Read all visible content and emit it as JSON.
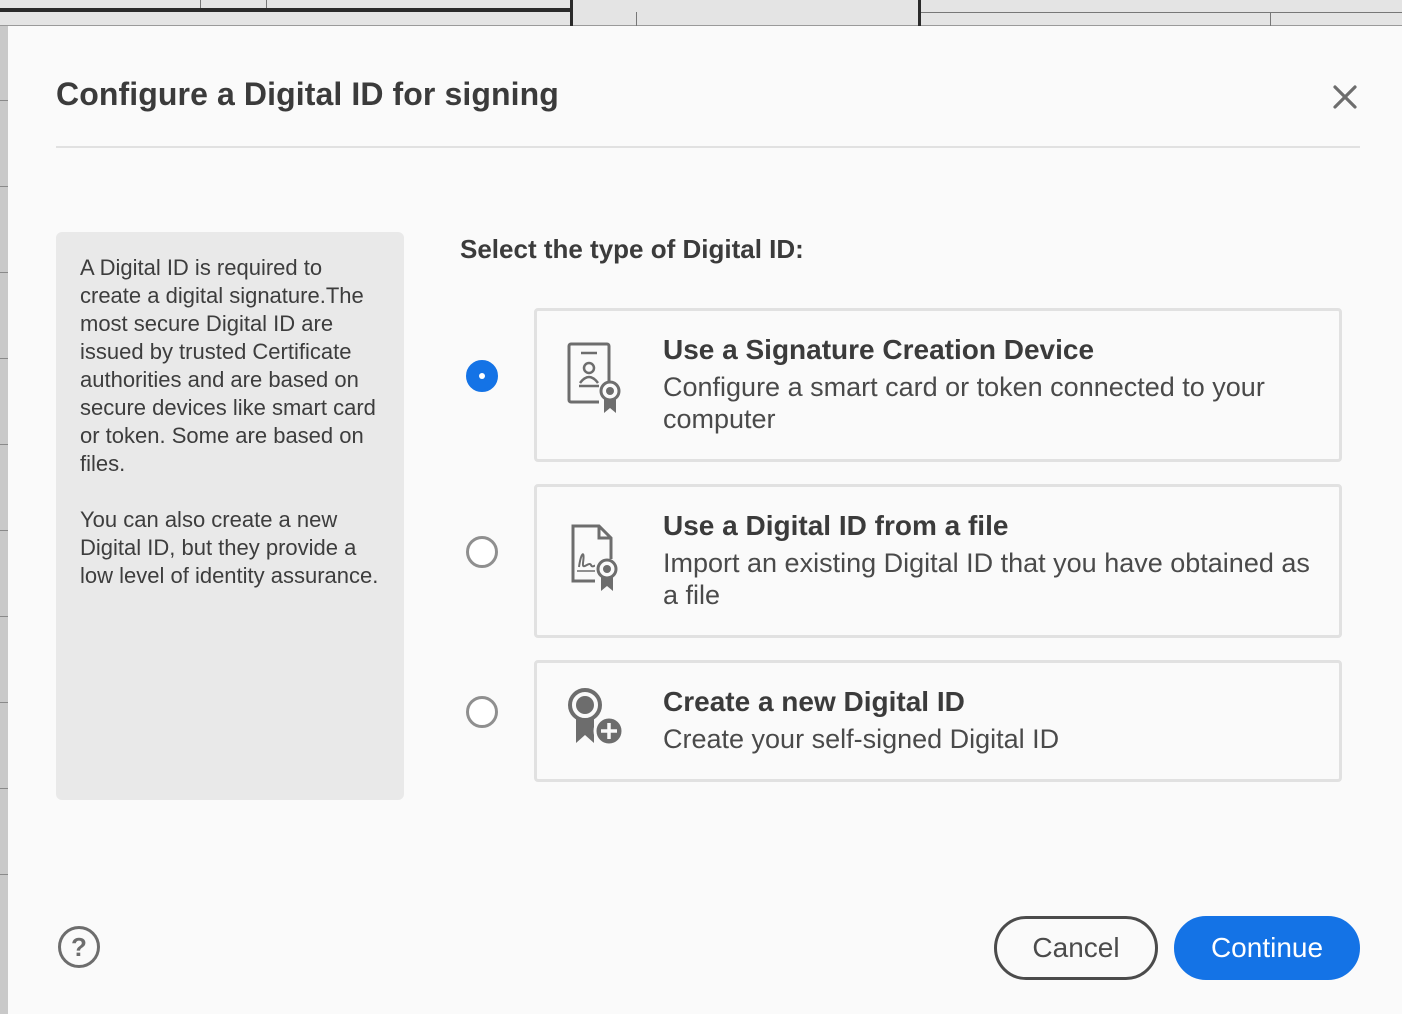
{
  "dialog": {
    "title": "Configure a Digital ID for signing",
    "close_icon": "close-icon"
  },
  "info": {
    "paragraph_1": "A Digital ID is required to create a digital signature.The most secure Digital ID are issued by trusted Certificate authorities and are based on secure devices like smart card or token. Some are based on files.",
    "paragraph_2": "You can also create a new Digital ID, but they provide a low level of identity assurance."
  },
  "selection": {
    "label": "Select the type of Digital ID:",
    "selected_index": 0,
    "options": [
      {
        "icon": "certificate-badge-icon",
        "title": "Use a Signature Creation Device",
        "description": "Configure a smart card or token connected to your computer"
      },
      {
        "icon": "signed-file-icon",
        "title": "Use a Digital ID from a file",
        "description": "Import an existing Digital ID that you have obtained as a file"
      },
      {
        "icon": "new-certificate-icon",
        "title": "Create a new Digital ID",
        "description": "Create your self-signed Digital ID"
      }
    ]
  },
  "footer": {
    "help_label": "?",
    "cancel_label": "Cancel",
    "continue_label": "Continue"
  },
  "colors": {
    "accent": "#1473e6",
    "text": "#3b3b3b",
    "panel": "#e9e9e9",
    "border": "#e1e1e1"
  }
}
